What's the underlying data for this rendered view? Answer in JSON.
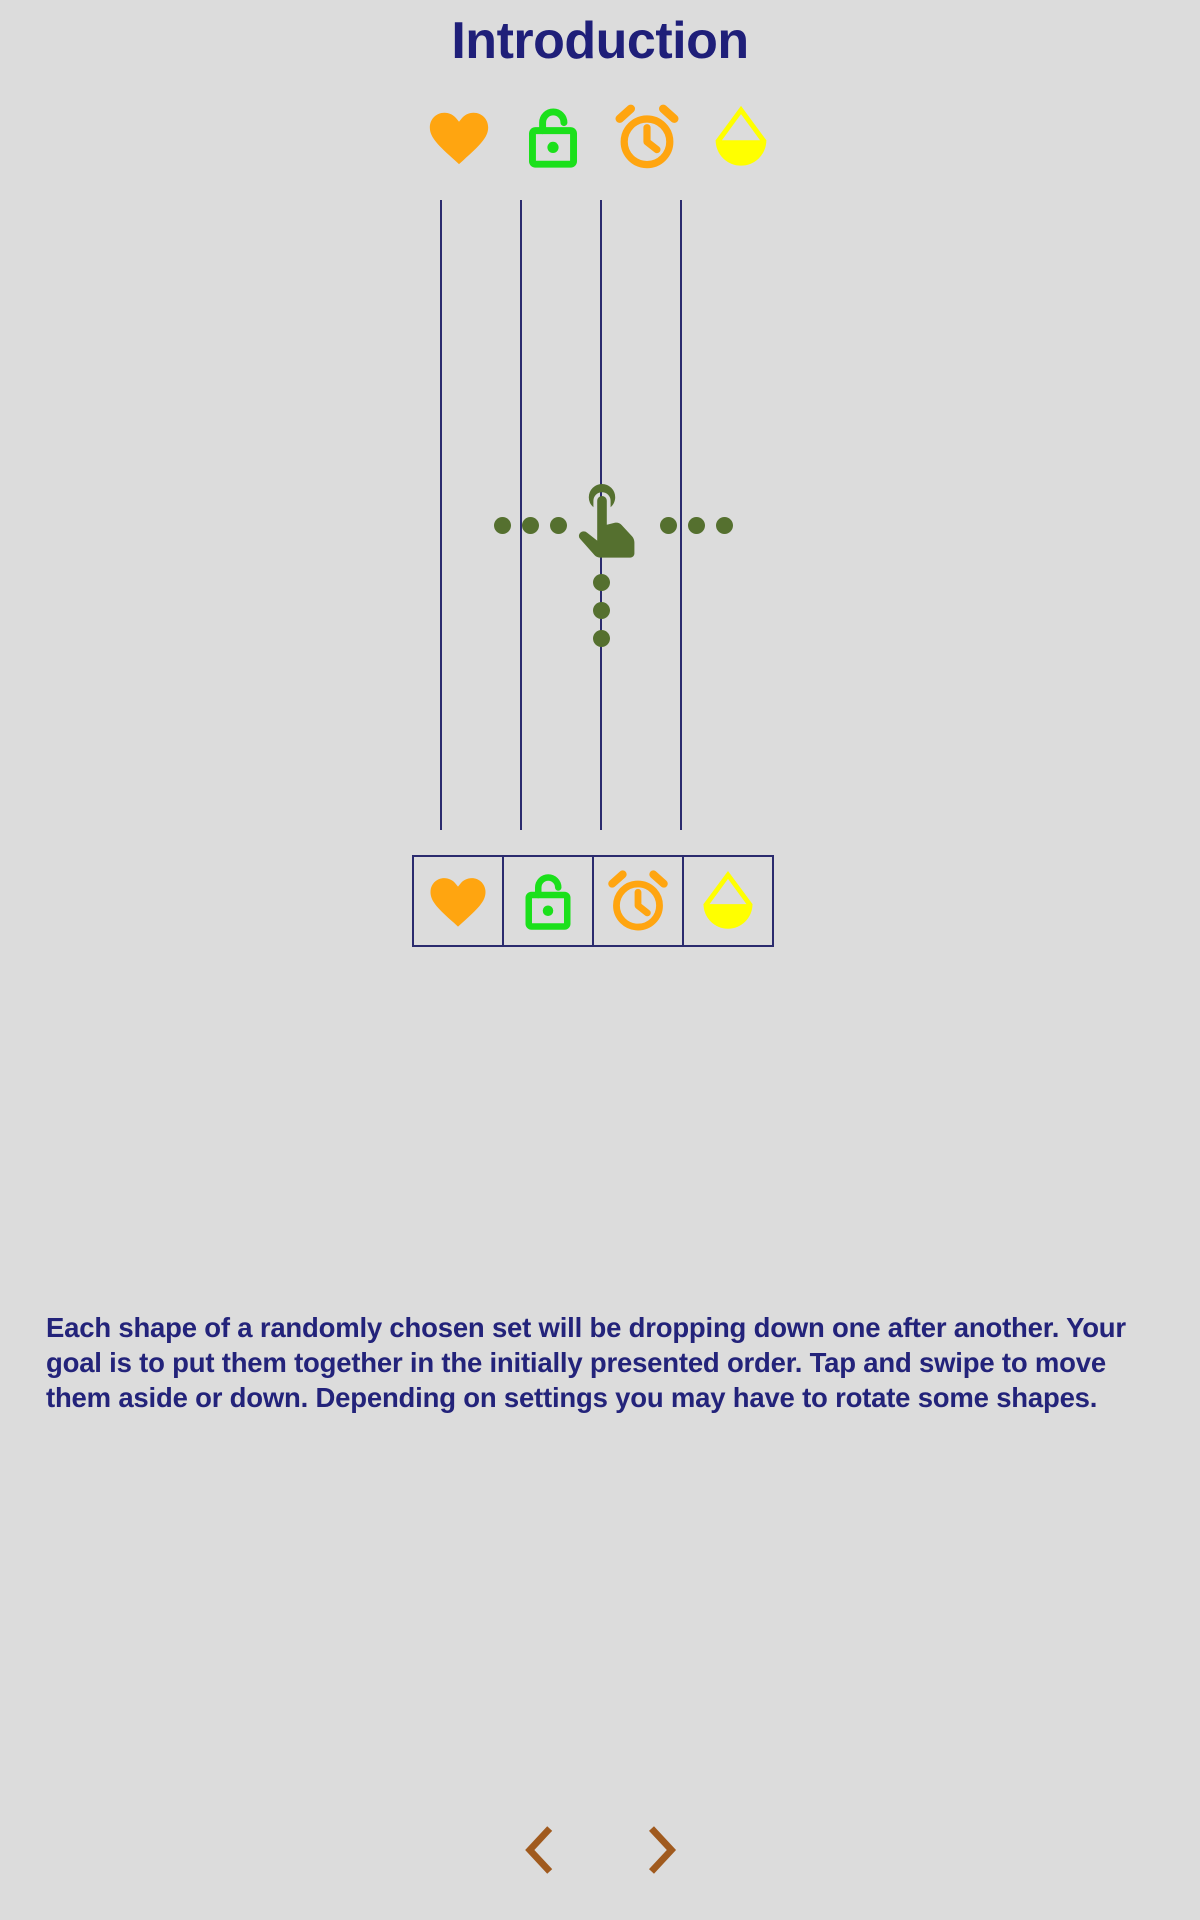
{
  "screen": {
    "title": "Introduction",
    "background_color": "#dcdcdc",
    "text_color": "#23237a",
    "accent_color": "#2b2b6e"
  },
  "preview": {
    "label": "shape-sequence-preview",
    "shapes": [
      {
        "name": "heart",
        "icon": "heart-icon",
        "color": "#FFA510",
        "style": "filled"
      },
      {
        "name": "unlocked padlock",
        "icon": "lock-open-icon",
        "color": "#1BE01B",
        "style": "outline"
      },
      {
        "name": "alarm clock",
        "icon": "alarm-clock-icon",
        "color": "#FFA510",
        "style": "outline"
      },
      {
        "name": "water drop",
        "icon": "water-drop-icon",
        "color": "#FFFF00",
        "style": "half-filled"
      }
    ]
  },
  "guides": {
    "label": "drop-column-guides",
    "count": 4,
    "color": "#2b2b6e",
    "positions": [
      28,
      108,
      188,
      268
    ]
  },
  "gesture": {
    "label": "tap-and-swipe-demo",
    "hand_icon": "tap-gesture-hand-icon",
    "dot_color": "#55702f",
    "left_dots": 3,
    "right_dots": 3,
    "down_dots": 3,
    "hint": "Tap and swipe to move shapes aside or down"
  },
  "tiles": {
    "label": "target-shape-row",
    "border_color": "#2b2b6e",
    "items": [
      {
        "name": "heart",
        "icon": "heart-icon",
        "color": "#FFA510",
        "style": "filled"
      },
      {
        "name": "unlocked padlock",
        "icon": "lock-open-icon",
        "color": "#1BE01B",
        "style": "outline"
      },
      {
        "name": "alarm clock",
        "icon": "alarm-clock-icon",
        "color": "#FFA510",
        "style": "outline"
      },
      {
        "name": "water drop",
        "icon": "water-drop-icon",
        "color": "#FFFF00",
        "style": "filled"
      }
    ]
  },
  "description": {
    "text": "Each shape of a randomly chosen set will be dropping down one after another. Your goal is to put them together in the initially presented order. Tap and swipe to move them aside or down. Depending on settings you may have to rotate some shapes."
  },
  "navigation": {
    "prev_label": "‹",
    "next_label": "›",
    "prev_name": "previous-page",
    "next_name": "next-page",
    "arrow_color": "#A05A1E"
  }
}
